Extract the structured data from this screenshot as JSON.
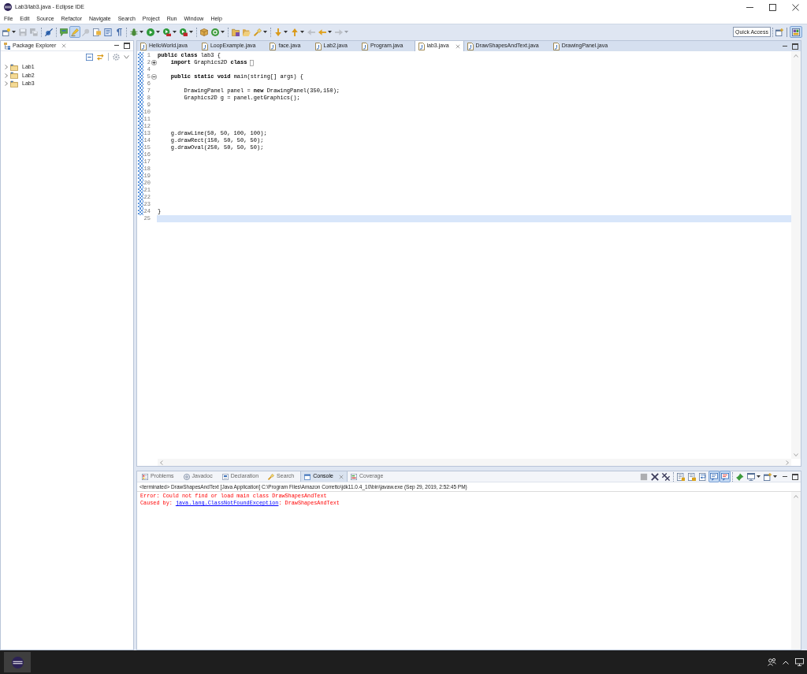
{
  "window": {
    "title": "Lab3/lab3.java - Eclipse IDE"
  },
  "menu": [
    "File",
    "Edit",
    "Source",
    "Refactor",
    "Navigate",
    "Search",
    "Project",
    "Run",
    "Window",
    "Help"
  ],
  "toolbar": {
    "groups": [
      [
        {
          "kind": "new",
          "dropdown": true,
          "disabled": false,
          "pressed": false
        },
        {
          "kind": "save",
          "dropdown": false,
          "disabled": true,
          "pressed": false
        },
        {
          "kind": "save_all",
          "dropdown": false,
          "disabled": true,
          "pressed": false
        }
      ],
      [
        {
          "kind": "skip",
          "dropdown": false,
          "disabled": false,
          "pressed": false
        }
      ],
      [
        {
          "kind": "bubble",
          "dropdown": false,
          "disabled": false,
          "pressed": false
        },
        {
          "kind": "highlighter",
          "dropdown": false,
          "disabled": false,
          "pressed": true
        },
        {
          "kind": "pin",
          "dropdown": false,
          "disabled": true,
          "pressed": false
        },
        {
          "kind": "doc",
          "dropdown": false,
          "disabled": false,
          "pressed": false
        },
        {
          "kind": "page",
          "dropdown": false,
          "disabled": false,
          "pressed": false
        },
        {
          "kind": "pilcrow",
          "dropdown": false,
          "disabled": false,
          "pressed": false
        }
      ],
      [
        {
          "kind": "debug",
          "dropdown": true,
          "disabled": false,
          "pressed": false
        },
        {
          "kind": "run",
          "dropdown": true,
          "disabled": false,
          "pressed": false
        },
        {
          "kind": "coverage",
          "dropdown": true,
          "disabled": false,
          "pressed": false
        },
        {
          "kind": "external",
          "dropdown": true,
          "disabled": false,
          "pressed": false
        }
      ],
      [
        {
          "kind": "package",
          "dropdown": false,
          "disabled": false,
          "pressed": false
        },
        {
          "kind": "class",
          "dropdown": true,
          "disabled": false,
          "pressed": false
        }
      ],
      [
        {
          "kind": "folder",
          "dropdown": false,
          "disabled": false,
          "pressed": false
        },
        {
          "kind": "open_folder",
          "dropdown": false,
          "disabled": false,
          "pressed": false
        },
        {
          "kind": "flashlight",
          "dropdown": true,
          "disabled": false,
          "pressed": false
        }
      ],
      [
        {
          "kind": "down",
          "dropdown": true,
          "disabled": false,
          "pressed": false
        },
        {
          "kind": "up",
          "dropdown": true,
          "disabled": false,
          "pressed": false
        },
        {
          "kind": "last_edit",
          "dropdown": false,
          "disabled": true,
          "pressed": false
        },
        {
          "kind": "back",
          "dropdown": true,
          "disabled": false,
          "pressed": false
        },
        {
          "kind": "forward",
          "dropdown": true,
          "disabled": true,
          "pressed": false
        }
      ]
    ],
    "quick_access": {
      "placeholder": "Quick Access"
    },
    "perspectives": [
      {
        "kind": "java",
        "selected": true
      }
    ]
  },
  "package_explorer": {
    "title": "Package Explorer",
    "projects": [
      {
        "label": "Lab1",
        "expanded": false,
        "selected": false
      },
      {
        "label": "Lab2",
        "expanded": false,
        "selected": false
      },
      {
        "label": "Lab3",
        "expanded": false,
        "selected": false
      }
    ]
  },
  "editor": {
    "tabs": [
      {
        "label": "HelloWorld.java",
        "selected": false
      },
      {
        "label": "LoopExample.java",
        "selected": false
      },
      {
        "label": "face.java",
        "selected": false
      },
      {
        "label": "Lab2.java",
        "selected": false
      },
      {
        "label": "Program.java",
        "selected": false
      },
      {
        "label": "lab3.java",
        "selected": true
      },
      {
        "label": "DrawShapesAndText.java",
        "selected": false
      },
      {
        "label": "DrawingPanel.java",
        "selected": false
      }
    ],
    "lines": [
      {
        "number": "1",
        "code": "**public** **class** lab3 {",
        "changed": true,
        "current": false
      },
      {
        "number": "2",
        "code": "    **import** Graphics2D **class**",
        "collapsed": true,
        "changed": true,
        "current": false
      },
      {
        "number": "4",
        "changed": true,
        "current": false
      },
      {
        "number": "5",
        "code": "    **public** **static** **void** main(string[] args) {",
        "collapsed": false,
        "changed": true,
        "current": false
      },
      {
        "number": "6",
        "changed": true,
        "current": false
      },
      {
        "number": "7",
        "code": "        DrawingPanel panel = **new** DrawingPanel(350,150);",
        "changed": true,
        "current": false
      },
      {
        "number": "8",
        "code": "        Graphics2D g = panel.getGraphics();",
        "changed": true,
        "current": false
      },
      {
        "number": "9",
        "changed": true,
        "current": false
      },
      {
        "number": "10",
        "changed": true,
        "current": false
      },
      {
        "number": "11",
        "changed": true,
        "current": false
      },
      {
        "number": "12",
        "changed": true,
        "current": false
      },
      {
        "number": "13",
        "code": "    g.drawLine(50, 50, 100, 100);",
        "changed": true,
        "current": false
      },
      {
        "number": "14",
        "code": "    g.drawRect(150, 50, 50, 50);",
        "changed": true,
        "current": false
      },
      {
        "number": "15",
        "code": "    g.drawOval(250, 50, 50, 50);",
        "changed": true,
        "current": false
      },
      {
        "number": "16",
        "changed": true,
        "current": false
      },
      {
        "number": "17",
        "changed": true,
        "current": false
      },
      {
        "number": "18",
        "changed": true,
        "current": false
      },
      {
        "number": "19",
        "changed": true,
        "current": false
      },
      {
        "number": "20",
        "changed": true,
        "current": false
      },
      {
        "number": "21",
        "changed": true,
        "current": false
      },
      {
        "number": "22",
        "changed": true,
        "current": false
      },
      {
        "number": "23",
        "changed": true,
        "current": false
      },
      {
        "number": "24",
        "code": "}",
        "changed": true,
        "current": false
      },
      {
        "number": "25",
        "changed": false,
        "current": true
      }
    ]
  },
  "console": {
    "tabs": [
      {
        "kind": "problems",
        "label": "Problems",
        "selected": false
      },
      {
        "kind": "javadoc",
        "label": "Javadoc",
        "selected": false
      },
      {
        "kind": "declaration",
        "label": "Declaration",
        "selected": false
      },
      {
        "kind": "search",
        "label": "Search",
        "selected": false
      },
      {
        "kind": "console",
        "label": "Console",
        "selected": true
      },
      {
        "kind": "coverage",
        "label": "Coverage",
        "selected": false
      }
    ],
    "toolbar": [
      [
        {
          "kind": "stop",
          "dropdown": false,
          "disabled": true,
          "pressed": false
        },
        {
          "kind": "remove",
          "dropdown": false,
          "disabled": false,
          "pressed": false
        },
        {
          "kind": "remove_all",
          "dropdown": false,
          "disabled": false,
          "pressed": false
        }
      ],
      [
        {
          "kind": "clear",
          "dropdown": false,
          "disabled": false,
          "pressed": false
        },
        {
          "kind": "scroll_lock",
          "dropdown": false,
          "disabled": false,
          "pressed": false
        },
        {
          "kind": "word_wrap",
          "dropdown": false,
          "disabled": false,
          "pressed": false
        },
        {
          "kind": "stdout",
          "dropdown": false,
          "disabled": false,
          "pressed": true
        },
        {
          "kind": "stderr",
          "dropdown": false,
          "disabled": false,
          "pressed": true
        }
      ],
      [
        {
          "kind": "pin_console",
          "dropdown": false,
          "disabled": false,
          "pressed": false
        },
        {
          "kind": "display",
          "dropdown": true,
          "disabled": false,
          "pressed": false
        },
        {
          "kind": "open_console",
          "dropdown": true,
          "disabled": false,
          "pressed": false
        }
      ]
    ],
    "header": "<terminated> DrawShapesAndText [Java Application] C:\\Program Files\\Amazon Corretto\\jdk11.0.4_10\\bin\\javaw.exe (Sep 29, 2019, 2:52:45 PM)",
    "output": [
      {
        "kind": "error",
        "segments": [
          {
            "kind": "text",
            "text": "Error: Could not find or load main class DrawShapesAndText"
          }
        ]
      },
      {
        "kind": "error",
        "segments": [
          {
            "kind": "text",
            "text": "Caused by: "
          },
          {
            "kind": "link",
            "text": "java.lang.ClassNotFoundException"
          },
          {
            "kind": "text",
            "text": ": DrawShapesAndText"
          }
        ]
      }
    ]
  },
  "taskbar": {
    "apps": [
      {
        "kind": "eclipse",
        "selected": true
      }
    ]
  }
}
